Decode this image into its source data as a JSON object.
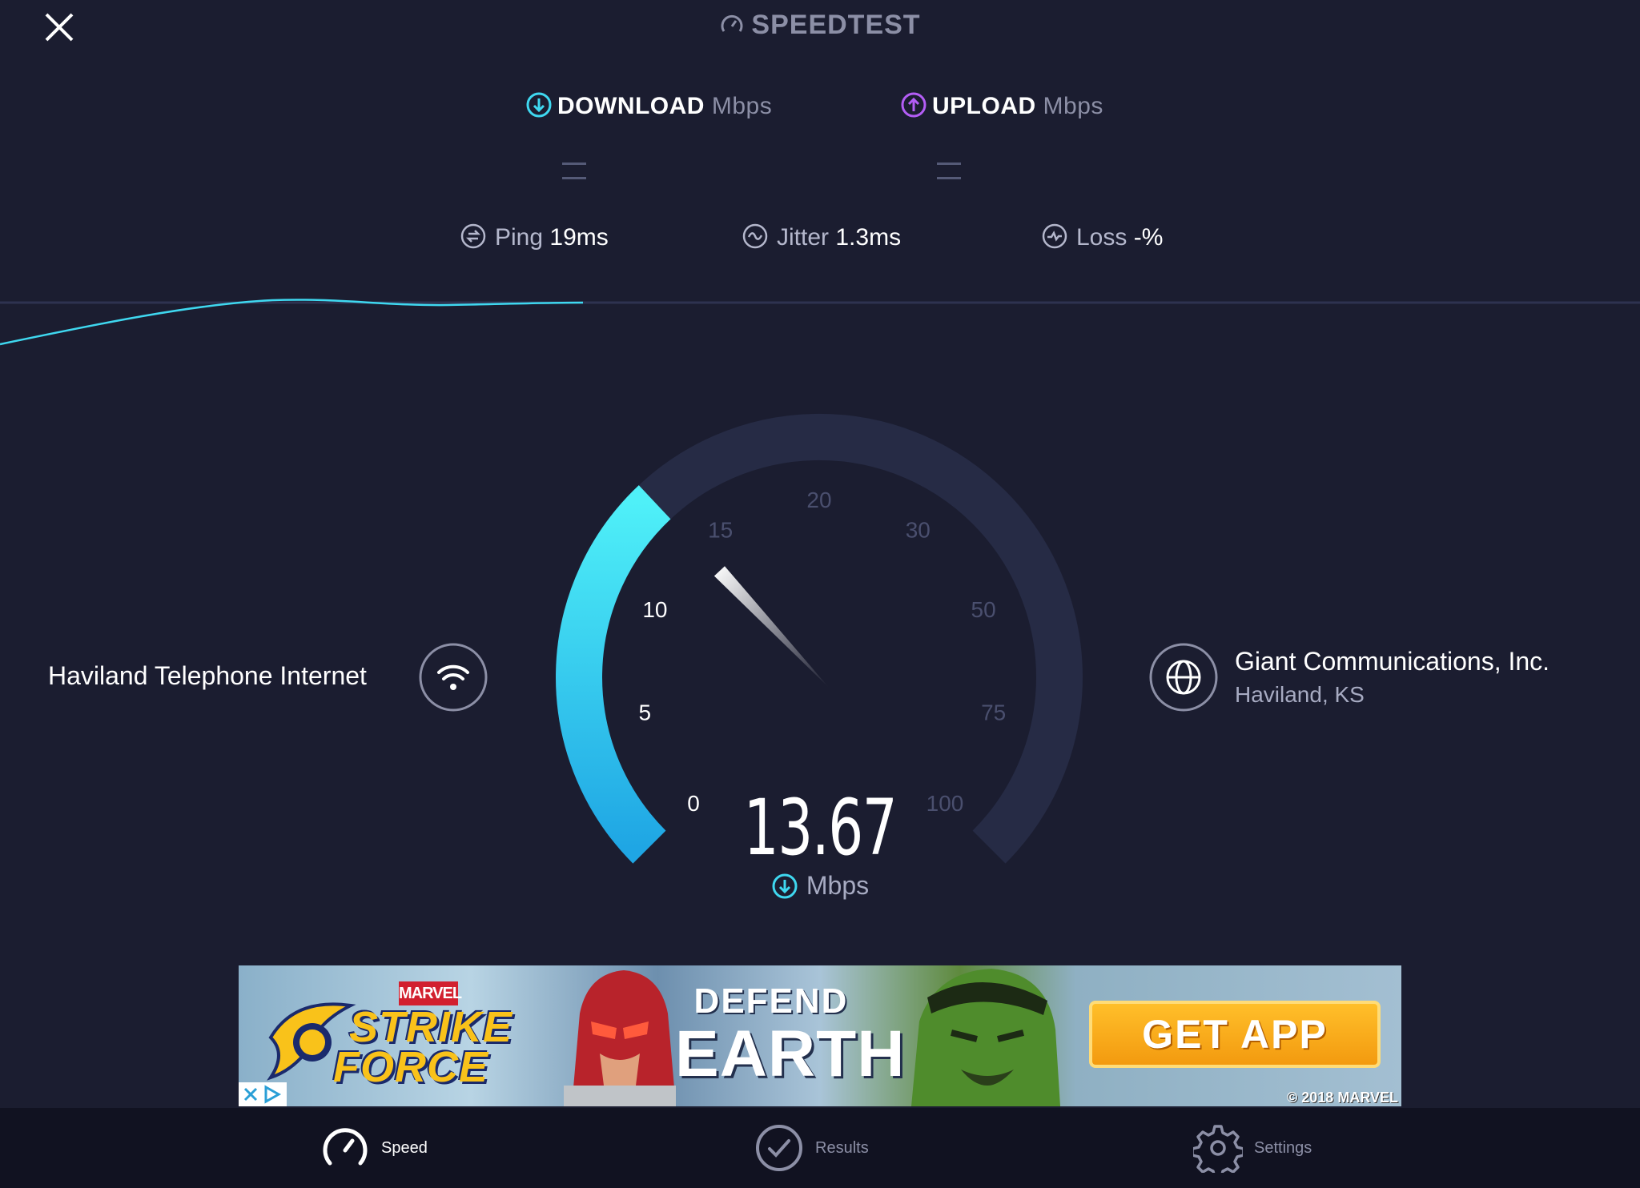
{
  "app": {
    "brand": "SPEEDTEST"
  },
  "metrics": {
    "download": {
      "label": "DOWNLOAD",
      "unit": "Mbps",
      "value": "— —"
    },
    "upload": {
      "label": "UPLOAD",
      "unit": "Mbps",
      "value": "— —"
    },
    "ping": {
      "label": "Ping",
      "value": "19",
      "unit": "ms"
    },
    "jitter": {
      "label": "Jitter",
      "value": "1.3",
      "unit": "ms"
    },
    "loss": {
      "label": "Loss",
      "value": "-",
      "unit": "%"
    }
  },
  "gauge": {
    "ticks": [
      "0",
      "5",
      "10",
      "15",
      "20",
      "30",
      "50",
      "75",
      "100"
    ],
    "current_value": "13.67",
    "unit": "Mbps",
    "progress": 0.34
  },
  "connection": {
    "isp": "Haviland Telephone Internet",
    "server_name": "Giant Communications, Inc.",
    "server_location": "Haviland, KS"
  },
  "ad": {
    "brand": "MARVEL",
    "title_line1": "STRIKE",
    "title_line2": "FORCE",
    "headline_top": "DEFEND",
    "headline_bottom": "EARTH",
    "cta": "GET APP",
    "copyright": "© 2018 MARVEL"
  },
  "nav": {
    "items": [
      {
        "label": "Speed",
        "icon": "speedometer-icon",
        "active": true
      },
      {
        "label": "Results",
        "icon": "check-circle-icon",
        "active": false
      },
      {
        "label": "Settings",
        "icon": "gear-icon",
        "active": false
      }
    ]
  },
  "colors": {
    "background": "#1b1d30",
    "download_accent": "#3fd8f0",
    "upload_accent": "#b35df5",
    "gauge_track": "#262b45"
  }
}
